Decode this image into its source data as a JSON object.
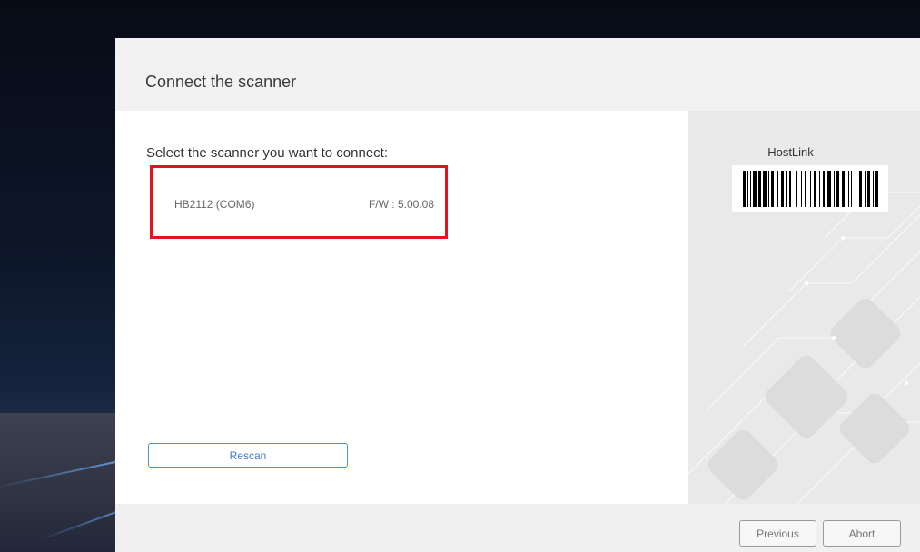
{
  "dialog": {
    "title": "Connect the scanner"
  },
  "content": {
    "prompt": "Select the scanner you want to connect:",
    "scanners": [
      {
        "name": "HB2112 (COM6)",
        "firmware": "F/W : 5.00.08"
      }
    ],
    "rescan_label": "Rescan"
  },
  "side_panel": {
    "barcode_label": "HostLink"
  },
  "footer": {
    "previous_label": "Previous",
    "abort_label": "Abort"
  },
  "colors": {
    "selection_border": "#e3141b",
    "accent": "#3b7bc8"
  }
}
